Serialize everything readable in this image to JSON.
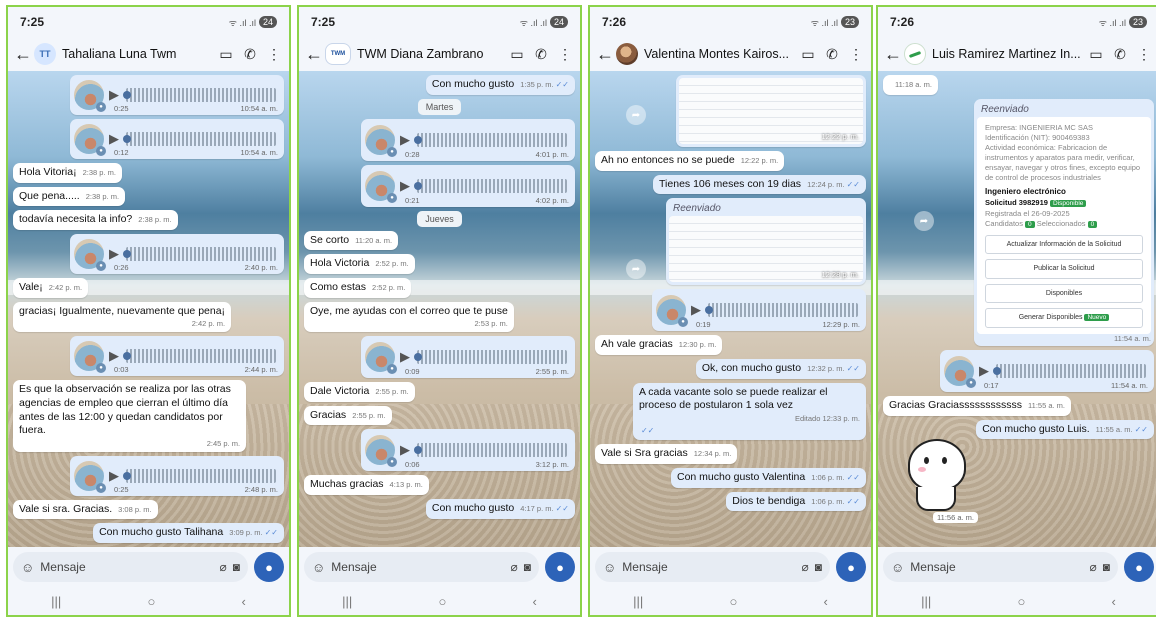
{
  "status": {
    "wifi_signal": "ᯤ .ıl .ıl"
  },
  "composer": {
    "placeholder": "Mensaje"
  },
  "phones": [
    {
      "time": "7:25",
      "battery": "24",
      "avatar_text": "TT",
      "name": "Tahaliana Luna Twm",
      "messages": [
        {
          "type": "audio",
          "dur": "0:25",
          "time": "10:54 a. m."
        },
        {
          "type": "audio",
          "dur": "0:12",
          "time": "10:54 a. m."
        },
        {
          "type": "in",
          "text": "Hola Vitoria¡",
          "time": "2:38 p. m."
        },
        {
          "type": "in",
          "text": "Que pena.....",
          "time": "2:38 p. m."
        },
        {
          "type": "in",
          "text": "todavía necesita la info?",
          "time": "2:38 p. m."
        },
        {
          "type": "audio",
          "dur": "0:26",
          "time": "2:40 p. m."
        },
        {
          "type": "in",
          "text": "Vale¡",
          "time": "2:42 p. m."
        },
        {
          "type": "in",
          "text": "gracias¡ Igualmente, nuevamente  que pena¡",
          "time": "2:42 p. m.",
          "block": true
        },
        {
          "type": "audio",
          "dur": "0:03",
          "time": "2:44 p. m."
        },
        {
          "type": "in",
          "text": "Es que la observación se realiza por las otras agencias de empleo que cierran el último día antes de las 12:00 y quedan candidatos por fuera.",
          "time": "2:45 p. m.",
          "block": true
        },
        {
          "type": "audio",
          "dur": "0:25",
          "time": "2:48 p. m."
        },
        {
          "type": "in",
          "text": "Vale si sra. Gracias.",
          "time": "3:08 p. m."
        },
        {
          "type": "out",
          "text": "Con mucho gusto Talihana",
          "time": "3:09 p. m."
        }
      ]
    },
    {
      "time": "7:25",
      "battery": "24",
      "avatar_text": "TWM",
      "name": "TWM Diana Zambrano",
      "messages": [
        {
          "type": "out",
          "text": "Con mucho gusto",
          "time": "1:35 p. m."
        },
        {
          "type": "day",
          "text": "Martes"
        },
        {
          "type": "audio",
          "dur": "0:28",
          "time": "4:01 p. m."
        },
        {
          "type": "audio",
          "dur": "0:21",
          "time": "4:02 p. m."
        },
        {
          "type": "day",
          "text": "Jueves"
        },
        {
          "type": "in",
          "text": "Se corto",
          "time": "11:20 a. m."
        },
        {
          "type": "in",
          "text": "Hola Victoria",
          "time": "2:52 p. m."
        },
        {
          "type": "in",
          "text": "Como estas",
          "time": "2:52 p. m."
        },
        {
          "type": "in",
          "text": "Oye, me ayudas con el correo que te puse",
          "time": "2:53 p. m.",
          "block": true
        },
        {
          "type": "audio",
          "dur": "0:09",
          "time": "2:55 p. m."
        },
        {
          "type": "in",
          "text": "Dale Victoria",
          "time": "2:55 p. m."
        },
        {
          "type": "in",
          "text": "Gracias",
          "time": "2:55 p. m."
        },
        {
          "type": "audio",
          "dur": "0:06",
          "time": "3:12 p. m."
        },
        {
          "type": "in",
          "text": "Muchas gracias",
          "time": "4:13 p. m."
        },
        {
          "type": "out",
          "text": "Con mucho gusto",
          "time": "4:17 p. m."
        }
      ]
    },
    {
      "time": "7:26",
      "battery": "23",
      "avatar_text": "",
      "name": "Valentina Montes Kairos...",
      "messages": [
        {
          "type": "doc",
          "time": "12:22 p. m."
        },
        {
          "type": "in",
          "text": "Ah no entonces no se puede",
          "time": "12:22 p. m."
        },
        {
          "type": "out",
          "text": "Tienes 106 meses con 19 dias",
          "time": "12:24 p. m."
        },
        {
          "type": "fwd",
          "label": "Reenviado",
          "time": "12:28 p. m."
        },
        {
          "type": "audio",
          "dur": "0:19",
          "time": "12:29 p. m."
        },
        {
          "type": "in",
          "text": "Ah vale gracias",
          "time": "12:30 p. m."
        },
        {
          "type": "out",
          "text": "Ok, con mucho gusto",
          "time": "12:32 p. m."
        },
        {
          "type": "out",
          "text": "A cada vacante solo se puede realizar el proceso de postularon 1 sola vez",
          "time": "Editado 12:33 p. m.",
          "block": true
        },
        {
          "type": "in",
          "text": "Vale si Sra gracias",
          "time": "12:34 p. m."
        },
        {
          "type": "out",
          "text": "Con mucho gusto Valentina",
          "time": "1:06 p. m."
        },
        {
          "type": "out",
          "text": "Dios te bendiga",
          "time": "1:06 p. m."
        }
      ]
    },
    {
      "time": "7:26",
      "battery": "23",
      "avatar_text": "",
      "name": "Luis Ramirez Martinez In...",
      "messages": [
        {
          "type": "in",
          "text": "",
          "time": "11:18 a. m."
        },
        {
          "type": "card",
          "label": "Reenviado",
          "time": "11:54 a. m.",
          "company": "Empresa: INGENIERIA MC SAS",
          "nit": "Identificación (NIT): 900469383",
          "activity": "Actividad económica: Fabricacion de instrumentos y aparatos para medir, verificar, ensayar, navegar y otros fines, excepto equipo de control de procesos industriales",
          "title": "Ingeniero electrónico",
          "request": "Solicitud 3982919",
          "badge": "Disponible",
          "registered": "Registrada el 26-09-2025",
          "candidates": "Candidatos",
          "cand_count": "0",
          "selected": "Seleccionados",
          "sel_count": "0",
          "buttons": [
            "Actualizar Información de la Solicitud",
            "Publicar la Solicitud",
            "Disponibles",
            "Generar Disponibles"
          ],
          "new_badge": "Nuevo"
        },
        {
          "type": "audio",
          "dur": "0:17",
          "time": "11:54 a. m."
        },
        {
          "type": "in",
          "text": "Gracias Graciassssssssssss",
          "time": "11:55 a. m."
        },
        {
          "type": "out",
          "text": "Con mucho gusto Luis.",
          "time": "11:55 a. m."
        }
      ],
      "sticker_time": "11:56 a. m."
    }
  ]
}
